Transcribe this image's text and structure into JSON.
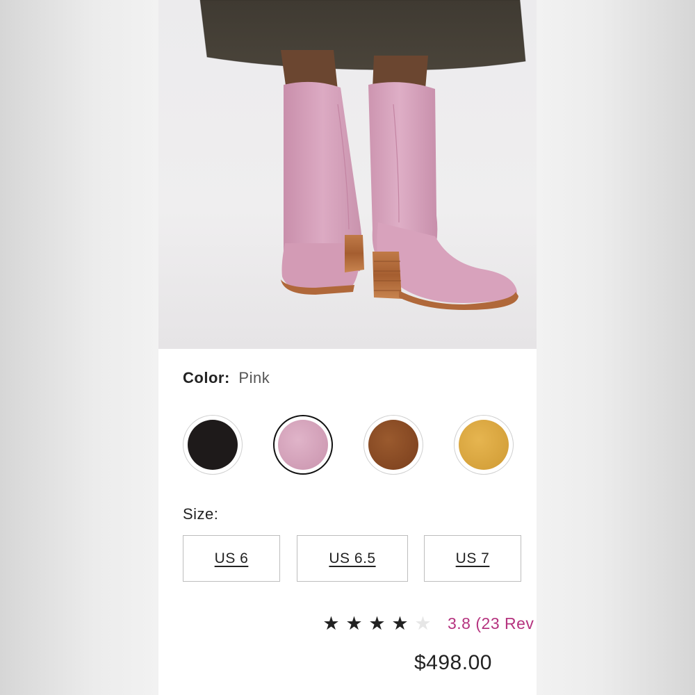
{
  "product": {
    "image_alt": "pink suede mid-calf boots",
    "color_label": "Color:",
    "color_value": "Pink",
    "swatches": [
      {
        "name": "Black",
        "hex": "#1e1a1a",
        "selected": false
      },
      {
        "name": "Pink",
        "hex": "#d7a5bd",
        "selected": true
      },
      {
        "name": "Brown",
        "hex": "#8a4a24",
        "selected": false
      },
      {
        "name": "Tan",
        "hex": "#dca742",
        "selected": false
      }
    ],
    "size_label": "Size:",
    "sizes": [
      "US 6",
      "US 6.5",
      "US 7"
    ],
    "rating": {
      "value": 3.8,
      "stars_filled": 4,
      "stars_total": 5,
      "text": "3.8 (23 Rev"
    },
    "price": "$498.00"
  },
  "colors": {
    "rating_accent": "#b5337f",
    "boot_pink": "#d9a7bf",
    "sole": "#b0683a"
  }
}
